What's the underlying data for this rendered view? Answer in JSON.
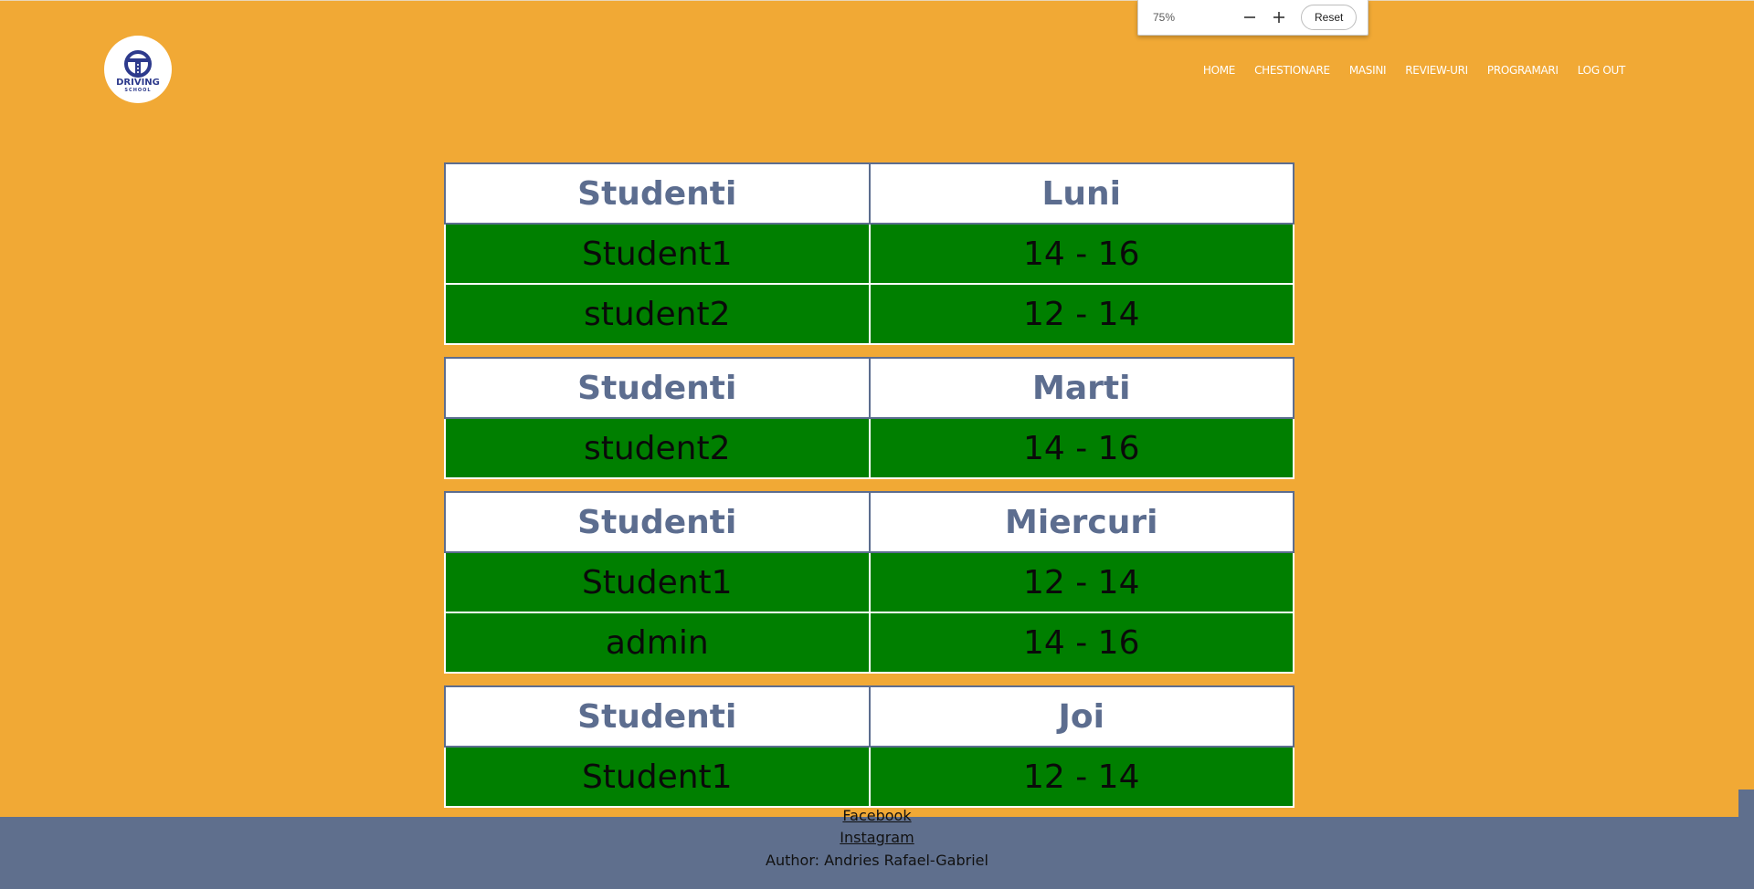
{
  "zoom": {
    "value": "75%",
    "reset_label": "Reset",
    "minus_icon": "minus-icon",
    "plus_icon": "plus-icon"
  },
  "logo": {
    "title": "DRIVING",
    "subtitle": "SCHOOL",
    "icon": "steering-wheel-icon",
    "color": "#2d3a8c"
  },
  "nav": {
    "items": [
      {
        "label": "HOME"
      },
      {
        "label": "CHESTIONARE"
      },
      {
        "label": "MASINI"
      },
      {
        "label": "REVIEW-URI"
      },
      {
        "label": "PROGRAMARI"
      },
      {
        "label": "LOG OUT"
      }
    ]
  },
  "schedule": [
    {
      "header": [
        "Studenti",
        "Luni"
      ],
      "rows": [
        [
          "Student1",
          "14 - 16"
        ],
        [
          "student2",
          "12 - 14"
        ]
      ]
    },
    {
      "header": [
        "Studenti",
        "Marti"
      ],
      "rows": [
        [
          "student2",
          "14 - 16"
        ]
      ]
    },
    {
      "header": [
        "Studenti",
        "Miercuri"
      ],
      "rows": [
        [
          "Student1",
          "12 - 14"
        ],
        [
          "admin",
          "14 - 16"
        ]
      ]
    },
    {
      "header": [
        "Studenti",
        "Joi"
      ],
      "rows": [
        [
          "Student1",
          "12 - 14"
        ]
      ]
    }
  ],
  "footer": {
    "facebook": "Facebook",
    "instagram": "Instagram",
    "author": "Author: Andries Rafael-Gabriel"
  },
  "colors": {
    "background": "#F1A935",
    "header_text": "#5c6d8f",
    "row_green": "#007f00",
    "footer": "#5f6f8d"
  }
}
